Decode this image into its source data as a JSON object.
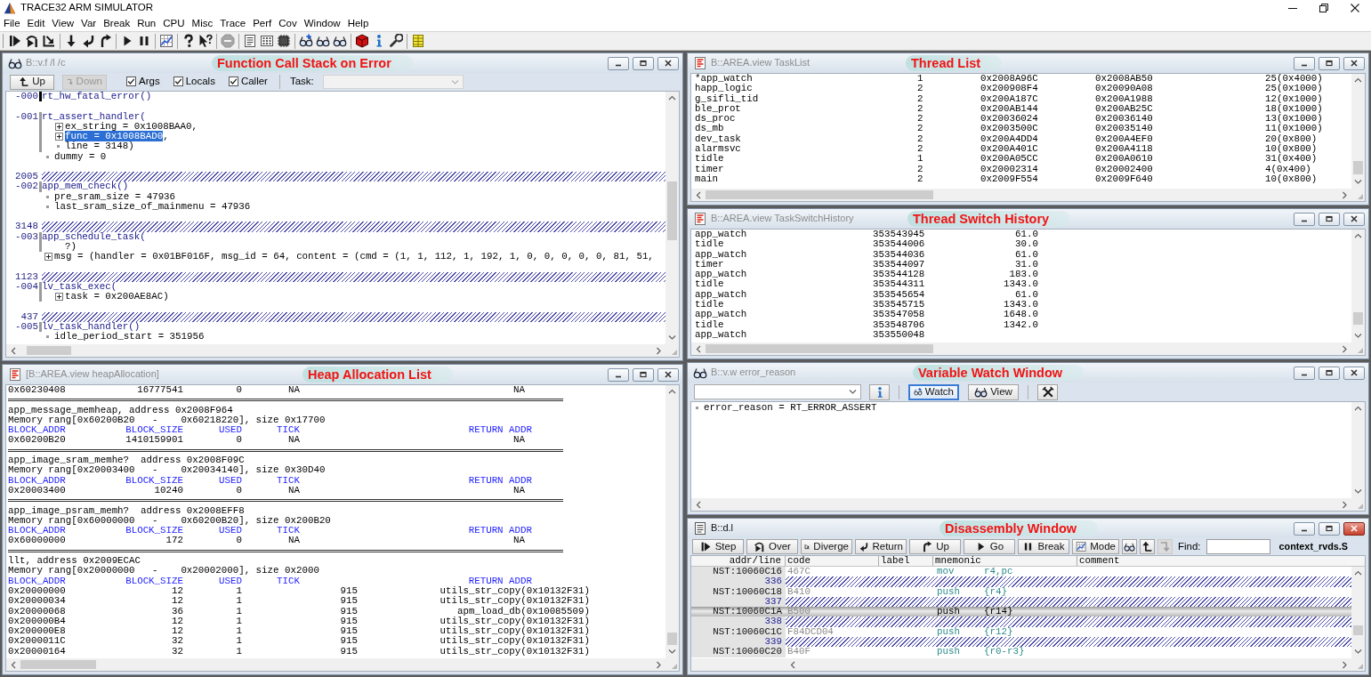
{
  "window": {
    "title": "TRACE32 ARM SIMULATOR"
  },
  "menu": [
    "File",
    "Edit",
    "View",
    "Var",
    "Break",
    "Run",
    "CPU",
    "Misc",
    "Trace",
    "Perf",
    "Cov",
    "Window",
    "Help"
  ],
  "toolbar": [
    [
      {
        "kind": "step",
        "disabled": false
      },
      {
        "kind": "over",
        "disabled": false
      },
      {
        "kind": "diverge",
        "disabled": false
      }
    ],
    [
      {
        "kind": "down",
        "disabled": false
      },
      {
        "kind": "return",
        "disabled": false
      },
      {
        "kind": "up",
        "disabled": false
      }
    ],
    [
      {
        "kind": "go",
        "disabled": false
      },
      {
        "kind": "break",
        "disabled": false
      }
    ],
    [
      {
        "kind": "mode",
        "disabled": false
      }
    ],
    [
      {
        "kind": "help",
        "disabled": false
      },
      {
        "kind": "pointer_help",
        "disabled": false
      }
    ],
    [
      {
        "kind": "stop",
        "disabled": true
      }
    ],
    [
      {
        "kind": "list",
        "disabled": false
      },
      {
        "kind": "data",
        "disabled": false
      },
      {
        "kind": "chip",
        "disabled": false
      }
    ],
    [
      {
        "kind": "watch",
        "disabled": false
      },
      {
        "kind": "view",
        "disabled": false
      },
      {
        "kind": "view",
        "disabled": false
      }
    ],
    [
      {
        "kind": "cube",
        "disabled": false
      },
      {
        "kind": "info",
        "disabled": false
      },
      {
        "kind": "wrench",
        "disabled": false
      }
    ],
    [
      {
        "kind": "grid",
        "disabled": false
      }
    ]
  ],
  "call_stack": {
    "title": "B::v.f /l /c",
    "caption": "Function Call Stack on Error",
    "active": false,
    "buttons": [
      {
        "kind": "up",
        "label": "Up",
        "disabled": false
      },
      {
        "kind": "down",
        "label": "Down",
        "disabled": true
      }
    ],
    "options": [
      {
        "label": "Args",
        "checked": true
      },
      {
        "label": "Locals",
        "checked": true
      },
      {
        "label": "Caller",
        "checked": true
      }
    ],
    "task": {
      "label": "Task:",
      "disabled": true
    },
    "frames": [
      {
        "index": "-000",
        "function": "rt_hw_fatal_error()",
        "current": true
      },
      {
        "index": "-001",
        "function": "rt_assert_handler(",
        "current": false,
        "args": [
          {
            "kind": "struct",
            "text": "ex_string = 0x1008BAA0",
            "suffix": ",",
            "selected": false
          },
          {
            "kind": "struct",
            "text": "func = 0x1008BAD0",
            "suffix": ",",
            "selected": true
          },
          {
            "kind": "scalar",
            "text": "line = 3148",
            "suffix": ")",
            "selected": false
          }
        ],
        "locals": [
          {
            "kind": "scalar",
            "text": "dummy = 0",
            "selected": false
          }
        ]
      },
      {
        "source_line": "2005",
        "index": "-002",
        "function": "app_mem_check()",
        "current": false,
        "locals": [
          {
            "kind": "scalar",
            "text": "pre_sram_size = 47936",
            "selected": false
          },
          {
            "kind": "scalar",
            "text": "last_sram_size_of_mainmenu = 47936",
            "selected": false
          }
        ]
      },
      {
        "source_line": "3148",
        "index": "-003",
        "function": "app_schedule_task(",
        "current": false,
        "args": [
          {
            "kind": "unknown",
            "text": "?",
            "suffix": ")",
            "selected": false
          }
        ],
        "locals": [
          {
            "kind": "struct",
            "text": "msg = (handler = 0x01BF016F, msg_id = 64, content = (cmd = (1, 1, 112, 1, 192, 1, 0, 0, 0, 0, 0, 81, 51,",
            "selected": false
          }
        ]
      },
      {
        "source_line": "1123",
        "index": "-004",
        "function": "lv_task_exec(",
        "current": false,
        "args": [
          {
            "kind": "struct",
            "text": "task = 0x200AE8AC",
            "suffix": ")",
            "selected": false
          }
        ]
      },
      {
        "source_line": "437",
        "index": "-005",
        "function": "lv_task_handler()",
        "current": false,
        "locals": [
          {
            "kind": "scalar",
            "text": "idle_period_start = 351956",
            "selected": false
          }
        ]
      }
    ]
  },
  "task_list": {
    "title": "B::AREA.view TaskList",
    "caption": "Thread List",
    "active": false,
    "rows": [
      [
        "*app_watch",
        "1",
        "0x2008A96C",
        "0x2008AB50",
        "25(0x4000)"
      ],
      [
        "happ_logic",
        "2",
        "0x200908F4",
        "0x20090A08",
        "25(0x1000)"
      ],
      [
        "g_sifli_tid",
        "2",
        "0x200A187C",
        "0x200A1988",
        "12(0x1000)"
      ],
      [
        "ble_prot",
        "2",
        "0x200AB144",
        "0x200AB25C",
        "18(0x1000)"
      ],
      [
        "ds_proc",
        "2",
        "0x20036024",
        "0x20036140",
        "13(0x1000)"
      ],
      [
        "ds_mb",
        "2",
        "0x2003500C",
        "0x20035140",
        "11(0x1000)"
      ],
      [
        "dev_task",
        "2",
        "0x200A4DD4",
        "0x200A4EF0",
        "20(0x800)"
      ],
      [
        "alarmsvc",
        "2",
        "0x200A401C",
        "0x200A4118",
        "10(0x800)"
      ],
      [
        "tidle",
        "1",
        "0x200A05CC",
        "0x200A0610",
        "31(0x400)"
      ],
      [
        "timer",
        "2",
        "0x20002314",
        "0x20002400",
        "4(0x400)"
      ],
      [
        "main",
        "2",
        "0x2009F554",
        "0x2009F640",
        "10(0x800)"
      ]
    ]
  },
  "task_switch_history": {
    "title": "B::AREA.view TaskSwitchHistory",
    "caption": "Thread Switch History",
    "active": false,
    "rows": [
      [
        "app_watch",
        "353543945",
        "61.0"
      ],
      [
        "tidle",
        "353544006",
        "30.0"
      ],
      [
        "app_watch",
        "353544036",
        "61.0"
      ],
      [
        "timer",
        "353544097",
        "31.0"
      ],
      [
        "app_watch",
        "353544128",
        "183.0"
      ],
      [
        "tidle",
        "353544311",
        "1343.0"
      ],
      [
        "app_watch",
        "353545654",
        "61.0"
      ],
      [
        "tidle",
        "353545715",
        "1343.0"
      ],
      [
        "app_watch",
        "353547058",
        "1648.0"
      ],
      [
        "tidle",
        "353548706",
        "1342.0"
      ],
      [
        "app_watch",
        "353550048"
      ]
    ]
  },
  "heap_allocation": {
    "title": "[B::AREA.view heapAllocation]",
    "caption": "Heap Allocation List",
    "active": false,
    "lines": [
      {
        "kind": "free",
        "cells": [
          "0x60230408",
          "16777541",
          "0",
          "NA",
          "NA"
        ]
      },
      {
        "kind": "separator"
      },
      {
        "kind": "text",
        "text": "app_message_memheap, address 0x2008F964"
      },
      {
        "kind": "text",
        "text": "Memory rang[0x60200B20   -    0x60218220], size 0x17700"
      },
      {
        "kind": "header",
        "cells": [
          "BLOCK_ADDR",
          "BLOCK_SIZE",
          "USED",
          "TICK",
          "RETURN ADDR"
        ]
      },
      {
        "kind": "free",
        "cells": [
          "0x60200B20",
          "1410159901",
          "0",
          "NA",
          "NA"
        ]
      },
      {
        "kind": "separator"
      },
      {
        "kind": "text",
        "text": "app_image_sram_memhe?  address 0x2008F09C"
      },
      {
        "kind": "text",
        "text": "Memory rang[0x20003400   -    0x20034140], size 0x30D40"
      },
      {
        "kind": "header",
        "cells": [
          "BLOCK_ADDR",
          "BLOCK_SIZE",
          "USED",
          "TICK",
          "RETURN ADDR"
        ]
      },
      {
        "kind": "free",
        "cells": [
          "0x20003400",
          "10240",
          "0",
          "NA",
          "NA"
        ]
      },
      {
        "kind": "separator"
      },
      {
        "kind": "text",
        "text": "app_image_psram_memh?  address 0x2008EFF8"
      },
      {
        "kind": "text",
        "text": "Memory rang[0x60000000   -    0x60200B20], size 0x200B20"
      },
      {
        "kind": "header",
        "cells": [
          "BLOCK_ADDR",
          "BLOCK_SIZE",
          "USED",
          "TICK",
          "RETURN ADDR"
        ]
      },
      {
        "kind": "free",
        "cells": [
          "0x60000000",
          "172",
          "0",
          "NA",
          "NA"
        ]
      },
      {
        "kind": "separator"
      },
      {
        "kind": "text",
        "text": "llt, address 0x2009ECAC"
      },
      {
        "kind": "text",
        "text": "Memory rang[0x20000000   -    0x20002000], size 0x2000"
      },
      {
        "kind": "header",
        "cells": [
          "BLOCK_ADDR",
          "BLOCK_SIZE",
          "USED",
          "TICK",
          "RETURN ADDR"
        ]
      },
      {
        "kind": "allocated",
        "cells": [
          "0x20000000",
          "12",
          "1",
          "915",
          "utils_str_copy(0x10132F31)"
        ]
      },
      {
        "kind": "allocated",
        "cells": [
          "0x20000034",
          "12",
          "1",
          "915",
          "utils_str_copy(0x10132F31)"
        ]
      },
      {
        "kind": "allocated",
        "cells": [
          "0x20000068",
          "36",
          "1",
          "915",
          "apm_load_db(0x10085509)"
        ]
      },
      {
        "kind": "allocated",
        "cells": [
          "0x200000B4",
          "12",
          "1",
          "915",
          "utils_str_copy(0x10132F31)"
        ]
      },
      {
        "kind": "allocated",
        "cells": [
          "0x200000E8",
          "12",
          "1",
          "915",
          "utils_str_copy(0x10132F31)"
        ]
      },
      {
        "kind": "allocated",
        "cells": [
          "0x2000011C",
          "32",
          "1",
          "915",
          "utils_str_copy(0x10132F31)"
        ]
      },
      {
        "kind": "allocated",
        "cells": [
          "0x20000164",
          "32",
          "1",
          "915",
          "utils_str_copy(0x10132F31)"
        ]
      }
    ]
  },
  "variable_watch": {
    "title": "B::v.w error_reason",
    "caption": "Variable Watch Window",
    "active": false,
    "buttons": [
      {
        "kind": "info",
        "selected": false
      },
      {
        "kind": "watch",
        "label": "Watch",
        "selected": true
      },
      {
        "kind": "view",
        "label": "View",
        "selected": false
      },
      {
        "kind": "clear",
        "selected": false
      }
    ],
    "variables": [
      {
        "kind": "scalar",
        "text": "error_reason = RT_ERROR_ASSERT",
        "selected": false
      }
    ]
  },
  "disassembly": {
    "title": "B::d.l",
    "caption": "Disassembly Window",
    "active": true,
    "buttons": [
      {
        "kind": "step",
        "label": "Step",
        "disabled": false
      },
      {
        "kind": "over",
        "label": "Over",
        "disabled": false
      },
      {
        "kind": "diverge",
        "label": "Diverge",
        "disabled": false
      },
      {
        "kind": "return",
        "label": "Return",
        "disabled": false
      },
      {
        "kind": "up",
        "label": "Up",
        "disabled": false
      },
      {
        "kind": "go",
        "label": "Go",
        "disabled": false
      },
      {
        "kind": "break",
        "label": "Break",
        "disabled": false
      },
      {
        "kind": "mode",
        "label": "Mode",
        "disabled": false
      },
      {
        "kind": "view",
        "disabled": false
      },
      {
        "kind": "up_frame",
        "disabled": false
      },
      {
        "kind": "down_frame",
        "disabled": true
      }
    ],
    "find_label": "Find:",
    "file": "context_rvds.S",
    "columns": [
      "addr/line",
      "code",
      "label",
      "mnemonic",
      "comment"
    ],
    "rows": [
      {
        "address": "NST:10060C16",
        "code": "467C",
        "mnemonic": "mov",
        "operands": "r4,pc",
        "selected": false
      },
      {
        "source_line": "336",
        "address": "NST:10060C18",
        "code": "B410",
        "mnemonic": "push",
        "operands": "{r4}",
        "selected": false
      },
      {
        "source_line": "337",
        "address": "NST:10060C1A",
        "code": "B500",
        "mnemonic": "push",
        "operands": "{r14}",
        "selected": true
      },
      {
        "source_line": "338",
        "address": "NST:10060C1C",
        "code": "F84DCD04",
        "mnemonic": "push",
        "operands": "{r12}",
        "selected": false
      },
      {
        "source_line": "339",
        "address": "NST:10060C20",
        "code": "B40F",
        "mnemonic": "push",
        "operands": "{r0-r3}",
        "selected": false
      }
    ]
  }
}
